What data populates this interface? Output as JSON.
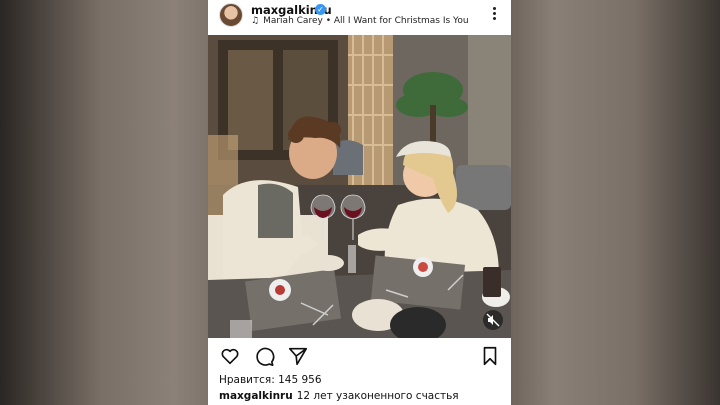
{
  "post": {
    "username": "maxgalkinru",
    "verified": true,
    "music": {
      "artist": "Mariah Carey",
      "separator": "•",
      "track": "All I Want for Christmas Is You"
    },
    "likes_label": "Нравится:",
    "likes_count": "145 956",
    "caption_username": "maxgalkinru",
    "caption_text": "12 лет узаконенного счастья"
  },
  "icons": {
    "more": "more-vertical-icon",
    "music": "music-note-icon",
    "like": "heart-icon",
    "comment": "comment-icon",
    "share": "send-icon",
    "save": "bookmark-icon",
    "mute": "speaker-muted-icon",
    "verified": "verified-badge-icon"
  },
  "colors": {
    "verified_blue": "#3897f0",
    "text": "#111111",
    "background": "#ffffff"
  }
}
